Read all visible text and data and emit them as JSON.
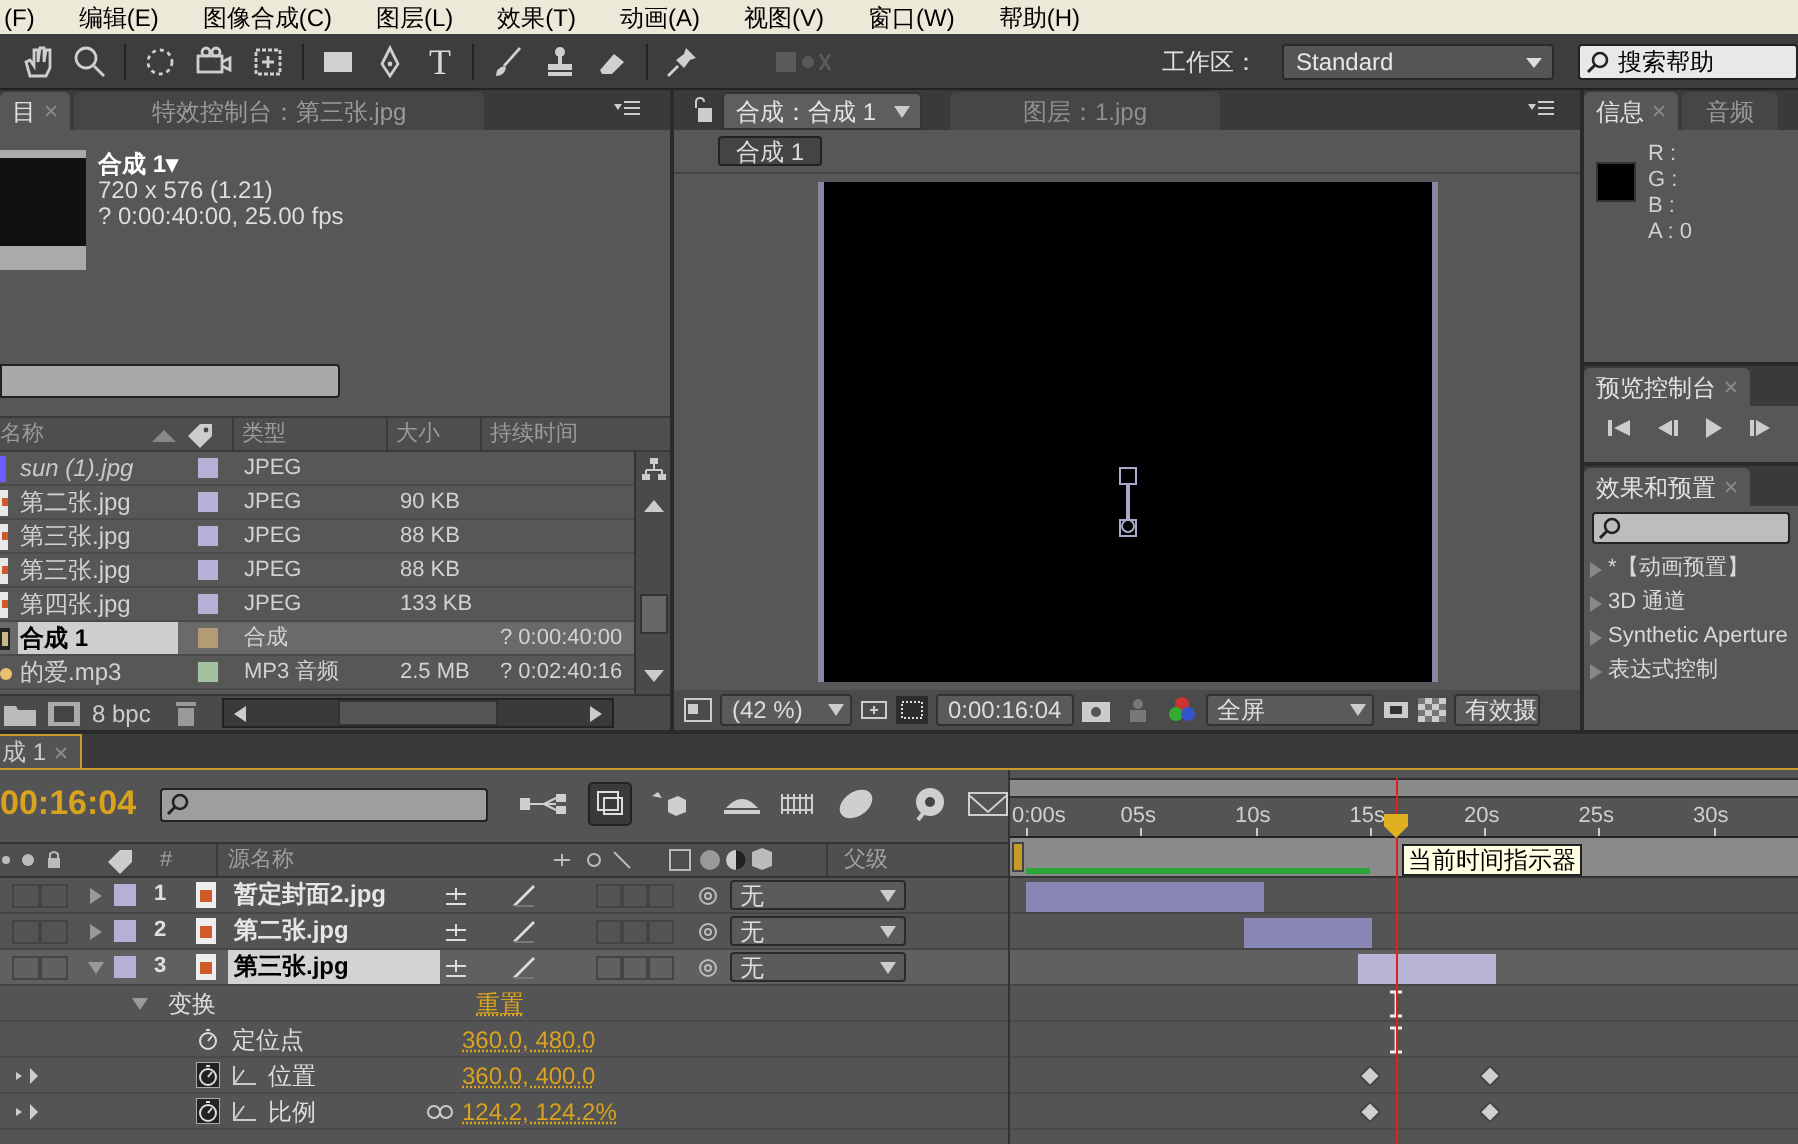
{
  "menu": [
    "(F)",
    "编辑(E)",
    "图像合成(C)",
    "图层(L)",
    "效果(T)",
    "动画(A)",
    "视图(V)",
    "窗口(W)",
    "帮助(H)"
  ],
  "toolbar": {
    "text_tool": "T",
    "workspace_label": "工作区：",
    "workspace": "Standard",
    "help_search": "搜索帮助"
  },
  "project_panel": {
    "tabs": [
      {
        "label": "目",
        "selected": true
      },
      {
        "label": "特效控制台：第三张.jpg",
        "selected": false
      }
    ],
    "comp_name": "合成 1▾",
    "comp_info": [
      "720 x 576 (1.21)",
      "? 0:00:40:00, 25.00 fps"
    ],
    "columns": [
      "名称",
      "类型",
      "大小",
      "持续时间"
    ],
    "rows": [
      {
        "kind": "missing",
        "name": "sun (1).jpg",
        "type": "JPEG",
        "color": "#b4b0d6",
        "selected": false
      },
      {
        "kind": "image",
        "name": "第二张.jpg",
        "type": "JPEG",
        "size": "90 KB",
        "color": "#b4b0d6",
        "selected": false
      },
      {
        "kind": "image",
        "name": "第三张.jpg",
        "type": "JPEG",
        "size": "88 KB",
        "color": "#b4b0d6",
        "selected": false
      },
      {
        "kind": "image",
        "name": "第三张.jpg",
        "type": "JPEG",
        "size": "88 KB",
        "color": "#b4b0d6",
        "selected": false
      },
      {
        "kind": "image",
        "name": "第四张.jpg",
        "type": "JPEG",
        "size": "133 KB",
        "color": "#b4b0d6",
        "selected": false
      },
      {
        "kind": "comp",
        "name": "合成 1",
        "type": "合成",
        "duration": "? 0:00:40:00",
        "color": "#b39b78",
        "selected": true
      },
      {
        "kind": "audio",
        "name": "的爱.mp3",
        "type": "MP3 音频",
        "size": "2.5 MB",
        "duration": "? 0:02:40:16",
        "color": "#a4c1a4",
        "selected": false
      }
    ],
    "bit_depth": "8 bpc"
  },
  "comp_panel": {
    "tabs": [
      {
        "label": "合成：合成 1",
        "selected": true
      },
      {
        "label": "图层：1.jpg",
        "selected": false
      }
    ],
    "breadcrumb": "合成 1",
    "zoom": "(42 %)",
    "timecode": "0:00:16:04",
    "resolution": "全屏",
    "view": "有效摄"
  },
  "info_panel": {
    "tabs": [
      {
        "label": "信息",
        "selected": true
      },
      {
        "label": "音频",
        "selected": false
      }
    ],
    "channels": [
      "R :",
      "G :",
      "B :",
      "A : 0"
    ]
  },
  "preview_panel": {
    "tab": "预览控制台"
  },
  "effects_panel": {
    "tab": "效果和预置",
    "items": [
      {
        "label": "*【动画预置】",
        "expanded": false
      },
      {
        "label": "3D 通道",
        "expanded": false
      },
      {
        "label": "Synthetic Aperture",
        "expanded": false
      },
      {
        "label": "表达式控制",
        "expanded": false
      }
    ]
  },
  "timeline": {
    "tab": "成 1",
    "timecode": "00:16:04",
    "columns": [
      "#",
      "源名称",
      "父级"
    ],
    "layers": [
      {
        "number": "1",
        "name": "暂定封面2.jpg",
        "parent": "无",
        "selected": false,
        "expanded": false
      },
      {
        "number": "2",
        "name": "第二张.jpg",
        "parent": "无",
        "selected": false,
        "expanded": false
      },
      {
        "number": "3",
        "name": "第三张.jpg",
        "parent": "无",
        "selected": true,
        "expanded": true
      }
    ],
    "properties": [
      {
        "kind": "group",
        "label": "变换",
        "value": "重置",
        "expanded": true
      },
      {
        "kind": "property",
        "label": "定位点",
        "value": "360.0, 480.0",
        "keyframed": false
      },
      {
        "kind": "property",
        "label": "位置",
        "value": "360.0, 400.0",
        "keyframed": true
      },
      {
        "kind": "property",
        "label": "比例",
        "value": "124.2, 124.2%",
        "keyframed": true,
        "linked": true
      }
    ],
    "ruler": [
      "0:00s",
      "05s",
      "10s",
      "15s",
      "20s",
      "25s",
      "30s"
    ],
    "tooltip": "当前时间指示器"
  }
}
